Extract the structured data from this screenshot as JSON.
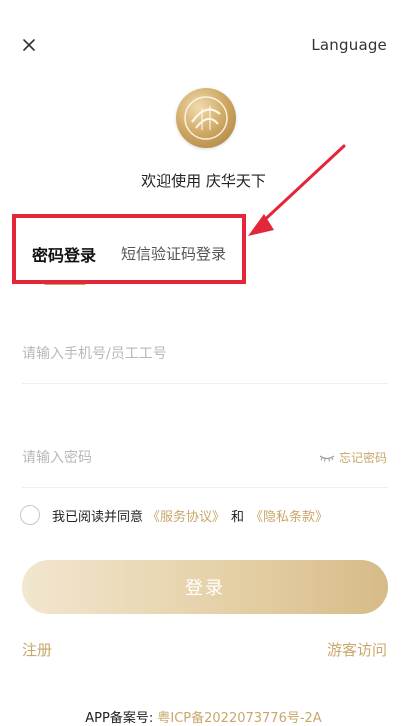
{
  "header": {
    "language_label": "Language"
  },
  "welcome_text": "欢迎使用 庆华天下",
  "tabs": [
    {
      "label": "密码登录",
      "active": true
    },
    {
      "label": "短信验证码登录",
      "active": false
    }
  ],
  "form": {
    "phone_placeholder": "请输入手机号/员工工号",
    "password_placeholder": "请输入密码",
    "forgot_label": "忘记密码"
  },
  "agreement": {
    "prefix": "我已阅读并同意",
    "service": "《服务协议》",
    "and": "和",
    "privacy": "《隐私条款》"
  },
  "login_button": "登录",
  "footer_links": {
    "register": "注册",
    "guest": "游客访问"
  },
  "icp": {
    "label": "APP备案号:",
    "number": "粤ICP备2022073776号-2A"
  },
  "colors": {
    "accent": "#c9a76b",
    "highlight": "#e3263a"
  },
  "icons": [
    "close-icon",
    "logo",
    "eye-closed-icon",
    "radio-unchecked"
  ]
}
